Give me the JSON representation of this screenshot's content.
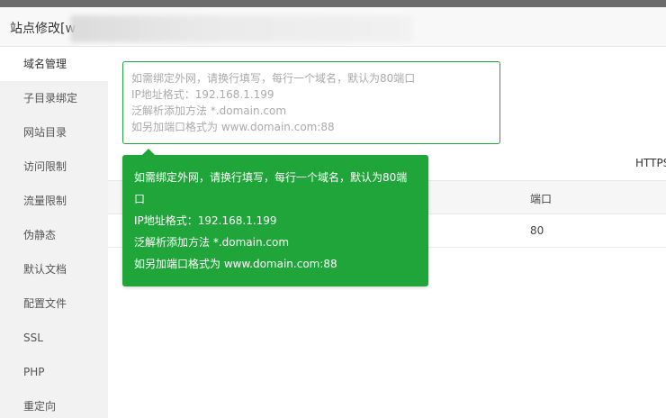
{
  "header": {
    "title": "站点修改[w"
  },
  "sidebar": {
    "items": [
      {
        "label": "域名管理",
        "active": true
      },
      {
        "label": "子目录绑定"
      },
      {
        "label": "网站目录"
      },
      {
        "label": "访问限制"
      },
      {
        "label": "流量限制"
      },
      {
        "label": "伪静态"
      },
      {
        "label": "默认文档"
      },
      {
        "label": "配置文件"
      },
      {
        "label": "SSL"
      },
      {
        "label": "PHP"
      },
      {
        "label": "重定向"
      }
    ]
  },
  "domain_input": {
    "placeholder_lines": [
      "如需绑定外网，请换行填写，每行一个域名，默认为80端口",
      "IP地址格式：192.168.1.199",
      "泛解析添加方法 *.domain.com",
      "如另加端口格式为 www.domain.com:88"
    ],
    "value": ""
  },
  "https_label": "HTTPS",
  "table": {
    "port_header": "端口",
    "rows": [
      {
        "port": "80"
      }
    ]
  },
  "tooltip": {
    "lines": [
      "如需绑定外网，请换行填写，每行一个域名，默认为80端",
      "口",
      "IP地址格式：192.168.1.199",
      "泛解析添加方法 *.domain.com",
      "如另加端口格式为 www.domain.com:88"
    ]
  },
  "colors": {
    "accent": "#20a53a",
    "sidebar_bg": "#f2f2f2",
    "header_bg": "#f8f8f8"
  }
}
